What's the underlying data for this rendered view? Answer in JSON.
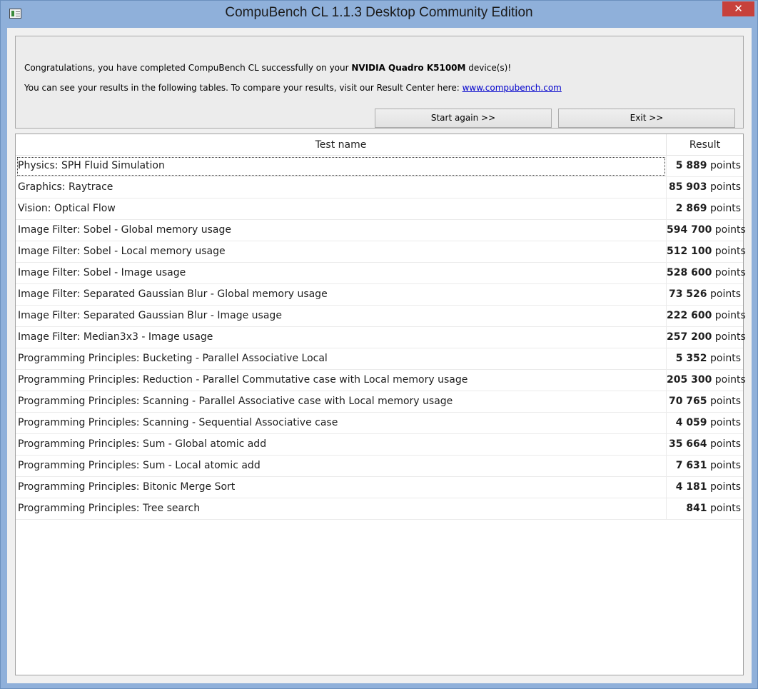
{
  "window": {
    "title": "CompuBench CL 1.1.3 Desktop Community Edition",
    "close_label": "✕"
  },
  "message": {
    "line1_prefix": "Congratulations, you have completed CompuBench CL successfully on your ",
    "device": "NVIDIA Quadro K5100M",
    "line1_suffix": " device(s)!",
    "line2_prefix": "You can see your results in the following tables. To compare your results, visit our Result Center here: ",
    "link": "www.compubench.com"
  },
  "buttons": {
    "start_again": "Start again >>",
    "exit": "Exit >>"
  },
  "table": {
    "columns": [
      "Test name",
      "Result"
    ],
    "unit": "points",
    "rows": [
      {
        "name": "Physics: SPH Fluid Simulation",
        "value": "5 889"
      },
      {
        "name": "Graphics: Raytrace",
        "value": "85 903"
      },
      {
        "name": "Vision: Optical Flow",
        "value": "2 869"
      },
      {
        "name": "Image Filter: Sobel - Global memory usage",
        "value": "594 700"
      },
      {
        "name": "Image Filter: Sobel - Local memory usage",
        "value": "512 100"
      },
      {
        "name": "Image Filter: Sobel - Image usage",
        "value": "528 600"
      },
      {
        "name": "Image Filter: Separated Gaussian Blur - Global memory usage",
        "value": "73 526"
      },
      {
        "name": "Image Filter: Separated Gaussian Blur - Image usage",
        "value": "222 600"
      },
      {
        "name": "Image Filter: Median3x3 - Image usage",
        "value": "257 200"
      },
      {
        "name": "Programming Principles: Bucketing - Parallel Associative Local",
        "value": "5 352"
      },
      {
        "name": "Programming Principles: Reduction - Parallel Commutative case with Local memory usage",
        "value": "205 300"
      },
      {
        "name": "Programming Principles: Scanning - Parallel Associative case with Local memory usage",
        "value": "70 765"
      },
      {
        "name": "Programming Principles: Scanning - Sequential Associative case",
        "value": "4 059"
      },
      {
        "name": "Programming Principles: Sum - Global atomic add",
        "value": "35 664"
      },
      {
        "name": "Programming Principles: Sum - Local atomic add",
        "value": "7 631"
      },
      {
        "name": "Programming Principles: Bitonic Merge Sort",
        "value": "4 181"
      },
      {
        "name": "Programming Principles: Tree search",
        "value": "841"
      }
    ]
  }
}
